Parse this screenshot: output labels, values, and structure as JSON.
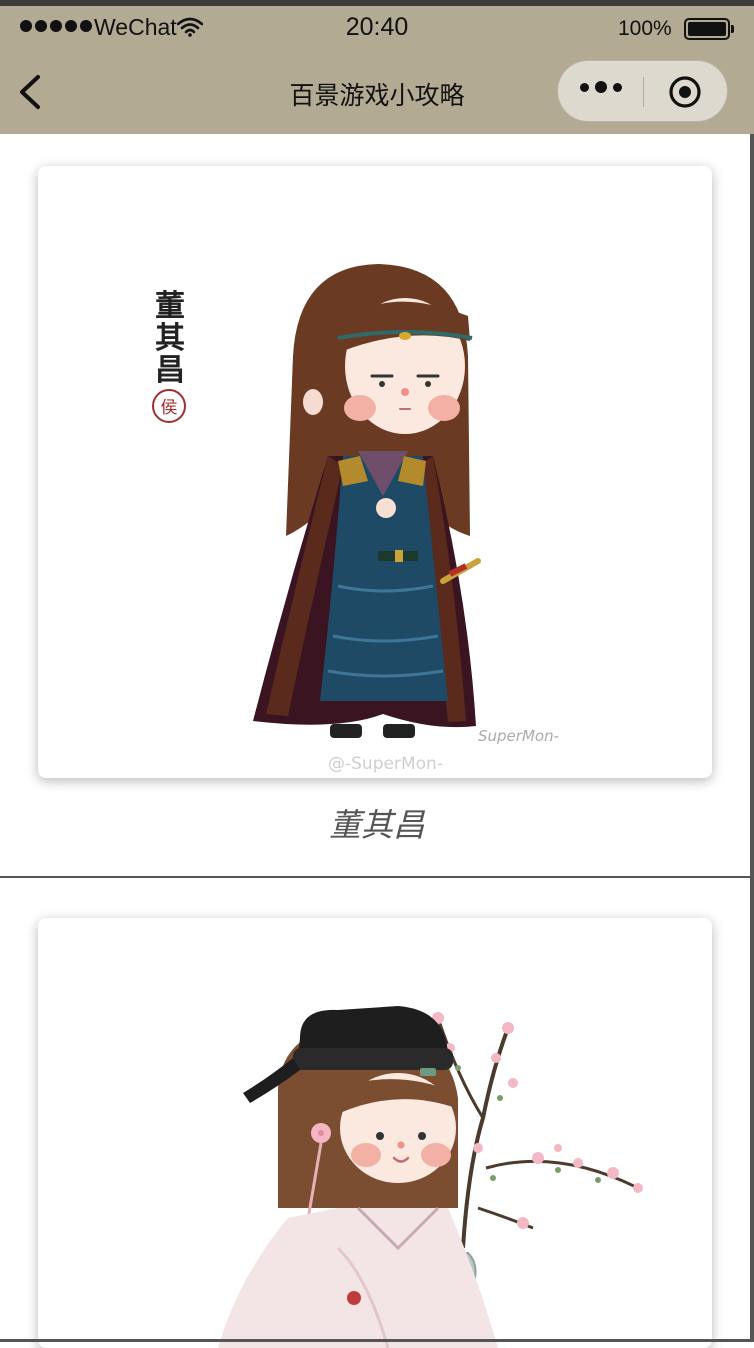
{
  "status_bar": {
    "carrier": "WeChat",
    "time": "20:40",
    "battery_percent": "100%",
    "battery_level": 1.0,
    "signal_bars": 5
  },
  "nav": {
    "title": "百景游戏小攻略",
    "back_icon": "chevron-left-icon",
    "more_icon": "more-dots-icon",
    "close_icon": "target-icon"
  },
  "colors": {
    "header_bg": "#b3aa93",
    "caption": "#555555",
    "separator": "#555555"
  },
  "cards": [
    {
      "caption": "董其昌",
      "image_name": "character-illustration-dong-qichang",
      "seal_text": "侯",
      "image_text": "董其昌",
      "watermark": "@-SuperMon-",
      "signature": "SuperMon-"
    },
    {
      "caption": "",
      "image_name": "character-illustration-blossom-branch"
    }
  ]
}
